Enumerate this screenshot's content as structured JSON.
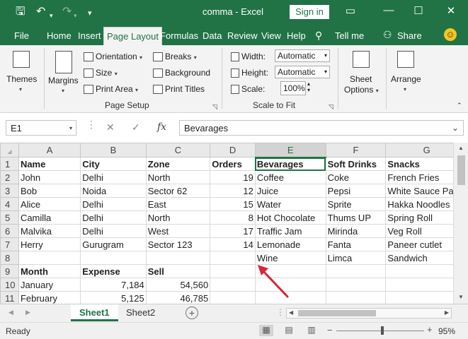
{
  "titlebar": {
    "title": "comma",
    "app_sep": "-",
    "app": "Excel",
    "sign_in": "Sign in",
    "save_glyph": "🖫",
    "undo_glyph": "↶",
    "redo_glyph": "↷",
    "qa_more": "▾",
    "ribbon_opts": "▭",
    "minimize": "—",
    "restore": "☐",
    "close": "✕"
  },
  "tabs": [
    {
      "label": "File"
    },
    {
      "label": "Home"
    },
    {
      "label": "Insert"
    },
    {
      "label": "Page Layout"
    },
    {
      "label": "Formulas"
    },
    {
      "label": "Data"
    },
    {
      "label": "Review"
    },
    {
      "label": "View"
    },
    {
      "label": "Help"
    },
    {
      "label": "Tell me"
    },
    {
      "label": "Share"
    }
  ],
  "ribbon": {
    "themes": "Themes",
    "margins": "Margins",
    "orientation": "Orientation",
    "size": "Size",
    "print_area": "Print Area",
    "breaks": "Breaks",
    "background": "Background",
    "print_titles": "Print Titles",
    "page_setup_label": "Page Setup",
    "width_label": "Width:",
    "width_value": "Automatic",
    "height_label": "Height:",
    "height_value": "Automatic",
    "scale_label": "Scale:",
    "scale_value": "100%",
    "scale_to_fit_label": "Scale to Fit",
    "sheet_options_1": "Sheet",
    "sheet_options_2": "Options",
    "arrange": "Arrange"
  },
  "formula_bar": {
    "name_box": "E1",
    "cancel": "✕",
    "enter": "✓",
    "fx": "fx",
    "value": "Bevarages"
  },
  "columns": [
    "A",
    "B",
    "C",
    "D",
    "E",
    "F",
    "G"
  ],
  "rows": [
    {
      "n": "1",
      "cells": [
        "Name",
        "City",
        "Zone",
        "Orders",
        "Bevarages",
        "Soft Drinks",
        "Snacks"
      ]
    },
    {
      "n": "2",
      "cells": [
        "John",
        "Delhi",
        "North",
        "19",
        "Coffee",
        "Coke",
        "French Fries"
      ]
    },
    {
      "n": "3",
      "cells": [
        "Bob",
        "Noida",
        "Sector 62",
        "12",
        "Juice",
        "Pepsi",
        "White Sauce Pasta"
      ]
    },
    {
      "n": "4",
      "cells": [
        "Alice",
        "Delhi",
        "East",
        "15",
        "Water",
        "Sprite",
        "Hakka Noodles"
      ]
    },
    {
      "n": "5",
      "cells": [
        "Camilla",
        "Delhi",
        "North",
        "8",
        "Hot Chocolate",
        "Thums UP",
        "Spring Roll"
      ]
    },
    {
      "n": "6",
      "cells": [
        "Malvika",
        "Delhi",
        "West",
        "17",
        "Traffic Jam",
        "Mirinda",
        "Veg Roll"
      ]
    },
    {
      "n": "7",
      "cells": [
        "Herry",
        "Gurugram",
        "Sector 123",
        "14",
        "Lemonade",
        "Fanta",
        "Paneer cutlet"
      ]
    },
    {
      "n": "8",
      "cells": [
        "",
        "",
        "",
        "",
        "Wine",
        "Limca",
        "Sandwich"
      ]
    },
    {
      "n": "9",
      "cells": [
        "Month",
        "Expense",
        "Sell",
        "",
        "",
        "",
        ""
      ]
    },
    {
      "n": "10",
      "cells": [
        "January",
        "7,184",
        "54,560",
        "",
        "",
        "",
        ""
      ]
    },
    {
      "n": "11",
      "cells": [
        "February",
        "5,125",
        "46,785",
        "",
        "",
        "",
        ""
      ]
    }
  ],
  "sheets": [
    {
      "label": "Sheet1",
      "active": true
    },
    {
      "label": "Sheet2",
      "active": false
    }
  ],
  "status": {
    "ready": "Ready",
    "zoom": "95%",
    "zoom_minus": "−",
    "zoom_plus": "+"
  },
  "colors": {
    "accent": "#217346",
    "annotation_arrow": "#d9263a"
  },
  "icons": [
    "save-icon",
    "undo-icon",
    "redo-icon",
    "lightbulb-icon",
    "share-icon",
    "smiley-icon",
    "themes-icon",
    "margins-icon",
    "orientation-icon",
    "size-icon",
    "print-area-icon",
    "breaks-icon",
    "background-icon",
    "print-titles-icon",
    "sheet-options-icon",
    "arrange-icon",
    "add-sheet-icon"
  ]
}
